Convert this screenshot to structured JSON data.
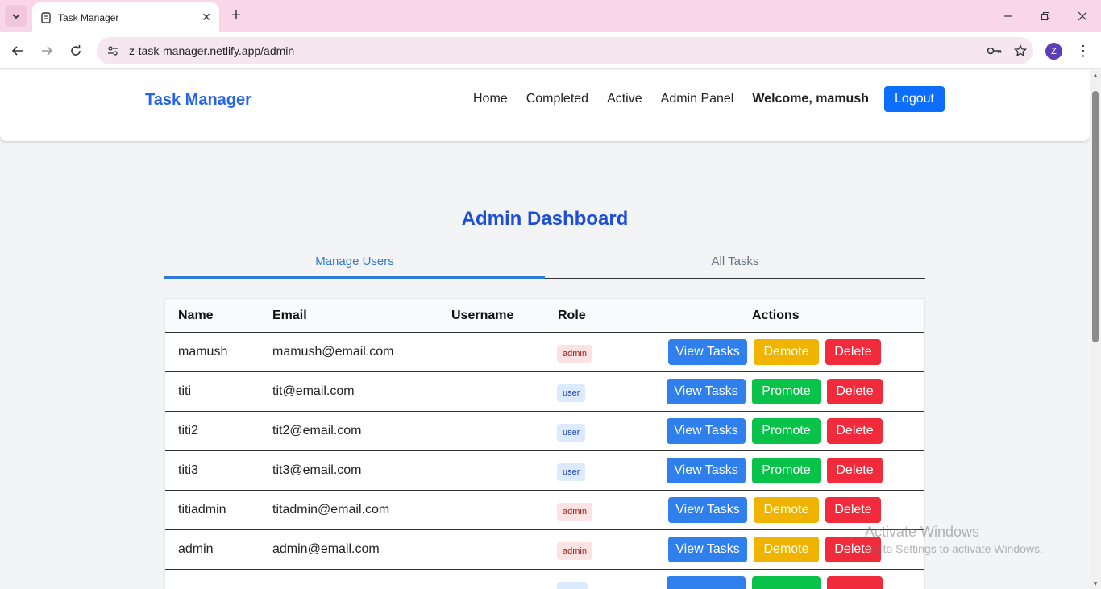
{
  "browser": {
    "tab_title": "Task Manager",
    "url": "z-task-manager.netlify.app/admin",
    "profile_initial": "Z"
  },
  "navbar": {
    "brand": "Task Manager",
    "links": [
      "Home",
      "Completed",
      "Active",
      "Admin Panel"
    ],
    "welcome": "Welcome, mamush",
    "logout_label": "Logout"
  },
  "dashboard": {
    "title": "Admin Dashboard",
    "tabs": [
      "Manage Users",
      "All Tasks"
    ],
    "active_tab": "Manage Users"
  },
  "table": {
    "headers": [
      "Name",
      "Email",
      "Username",
      "Role",
      "Actions"
    ],
    "rows": [
      {
        "name": "mamush",
        "email": "mamush@email.com",
        "username": "",
        "role": "admin",
        "actions": [
          "View Tasks",
          "Demote",
          "Delete"
        ]
      },
      {
        "name": "titi",
        "email": "tit@email.com",
        "username": "",
        "role": "user",
        "actions": [
          "View Tasks",
          "Promote",
          "Delete"
        ]
      },
      {
        "name": "titi2",
        "email": "tit2@email.com",
        "username": "",
        "role": "user",
        "actions": [
          "View Tasks",
          "Promote",
          "Delete"
        ]
      },
      {
        "name": "titi3",
        "email": "tit3@email.com",
        "username": "",
        "role": "user",
        "actions": [
          "View Tasks",
          "Promote",
          "Delete"
        ]
      },
      {
        "name": "titiadmin",
        "email": "titadmin@email.com",
        "username": "",
        "role": "admin",
        "actions": [
          "View Tasks",
          "Demote",
          "Delete"
        ]
      },
      {
        "name": "admin",
        "email": "admin@email.com",
        "username": "",
        "role": "admin",
        "actions": [
          "View Tasks",
          "Demote",
          "Delete"
        ]
      }
    ]
  },
  "watermark": {
    "title": "Activate Windows",
    "subtitle": "Go to Settings to activate Windows."
  },
  "colors": {
    "brand": "#2563eb",
    "primary": "#0d6efd",
    "view": "#2f80ed",
    "demote": "#f0b400",
    "promote": "#08c24a",
    "delete": "#f22b3c"
  }
}
